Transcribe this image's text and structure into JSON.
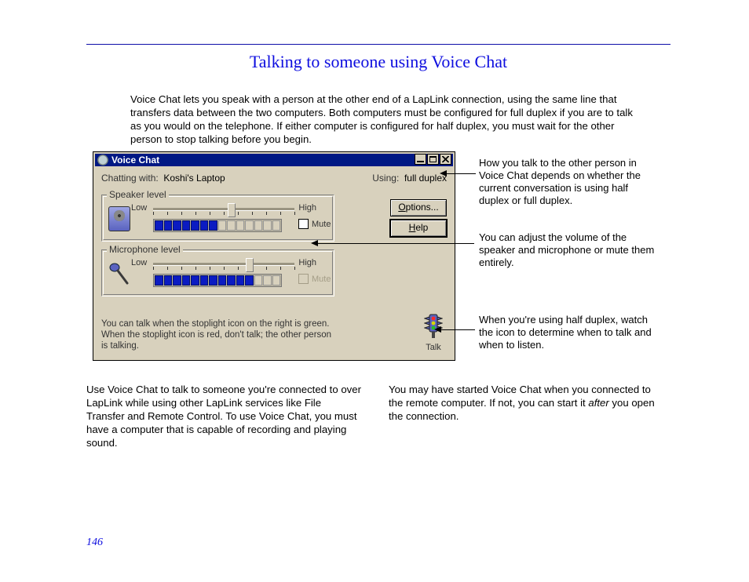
{
  "title": "Talking to someone using Voice Chat",
  "intro": "Voice Chat lets you speak with a person at the other end of a LapLink connection, using the same line that transfers data between the two computers. Both computers must be configured for full duplex if you are to talk as you would on the telephone. If either computer is configured for half duplex, you must wait for the other person to stop talking before you begin.",
  "window": {
    "title": "Voice Chat",
    "chatting_label": "Chatting with:",
    "chatting_value": "Koshi's Laptop",
    "using_label": "Using:",
    "using_value": "full duplex",
    "options_btn": "Options...",
    "help_btn": "Help",
    "speaker": {
      "group": "Speaker level",
      "low": "Low",
      "high": "High",
      "mute_label": "Mute",
      "slider_pos_pct": 55,
      "vu_segments": 14,
      "vu_on": 7,
      "mute_checked": false,
      "mute_disabled": false
    },
    "mic": {
      "group": "Microphone level",
      "low": "Low",
      "high": "High",
      "mute_label": "Mute",
      "slider_pos_pct": 68,
      "vu_segments": 14,
      "vu_on": 11,
      "mute_checked": false,
      "mute_disabled": true
    },
    "hint": "You can talk when the stoplight icon on the right is green. When the stoplight icon is red, don't talk; the other person is talking.",
    "talk_label": "Talk"
  },
  "annotations": {
    "a1": "How you talk to the other person in Voice Chat depends on whether the current conversation is using half duplex or full duplex.",
    "a2": "You can adjust the volume of the speaker and microphone or mute them entirely.",
    "a3": "When you're using half duplex, watch the icon to determine when to talk and when to listen."
  },
  "columns": {
    "left": "Use Voice Chat to talk to someone you're connected to over LapLink while using other LapLink services like File Transfer and Remote Control. To use Voice Chat, you must have a computer that is capable of recording and playing sound.",
    "right_a": "You may have started Voice Chat when you connected to the remote computer. If not, you can start it ",
    "right_em": "after",
    "right_b": " you open the connection."
  },
  "page_number": "146"
}
